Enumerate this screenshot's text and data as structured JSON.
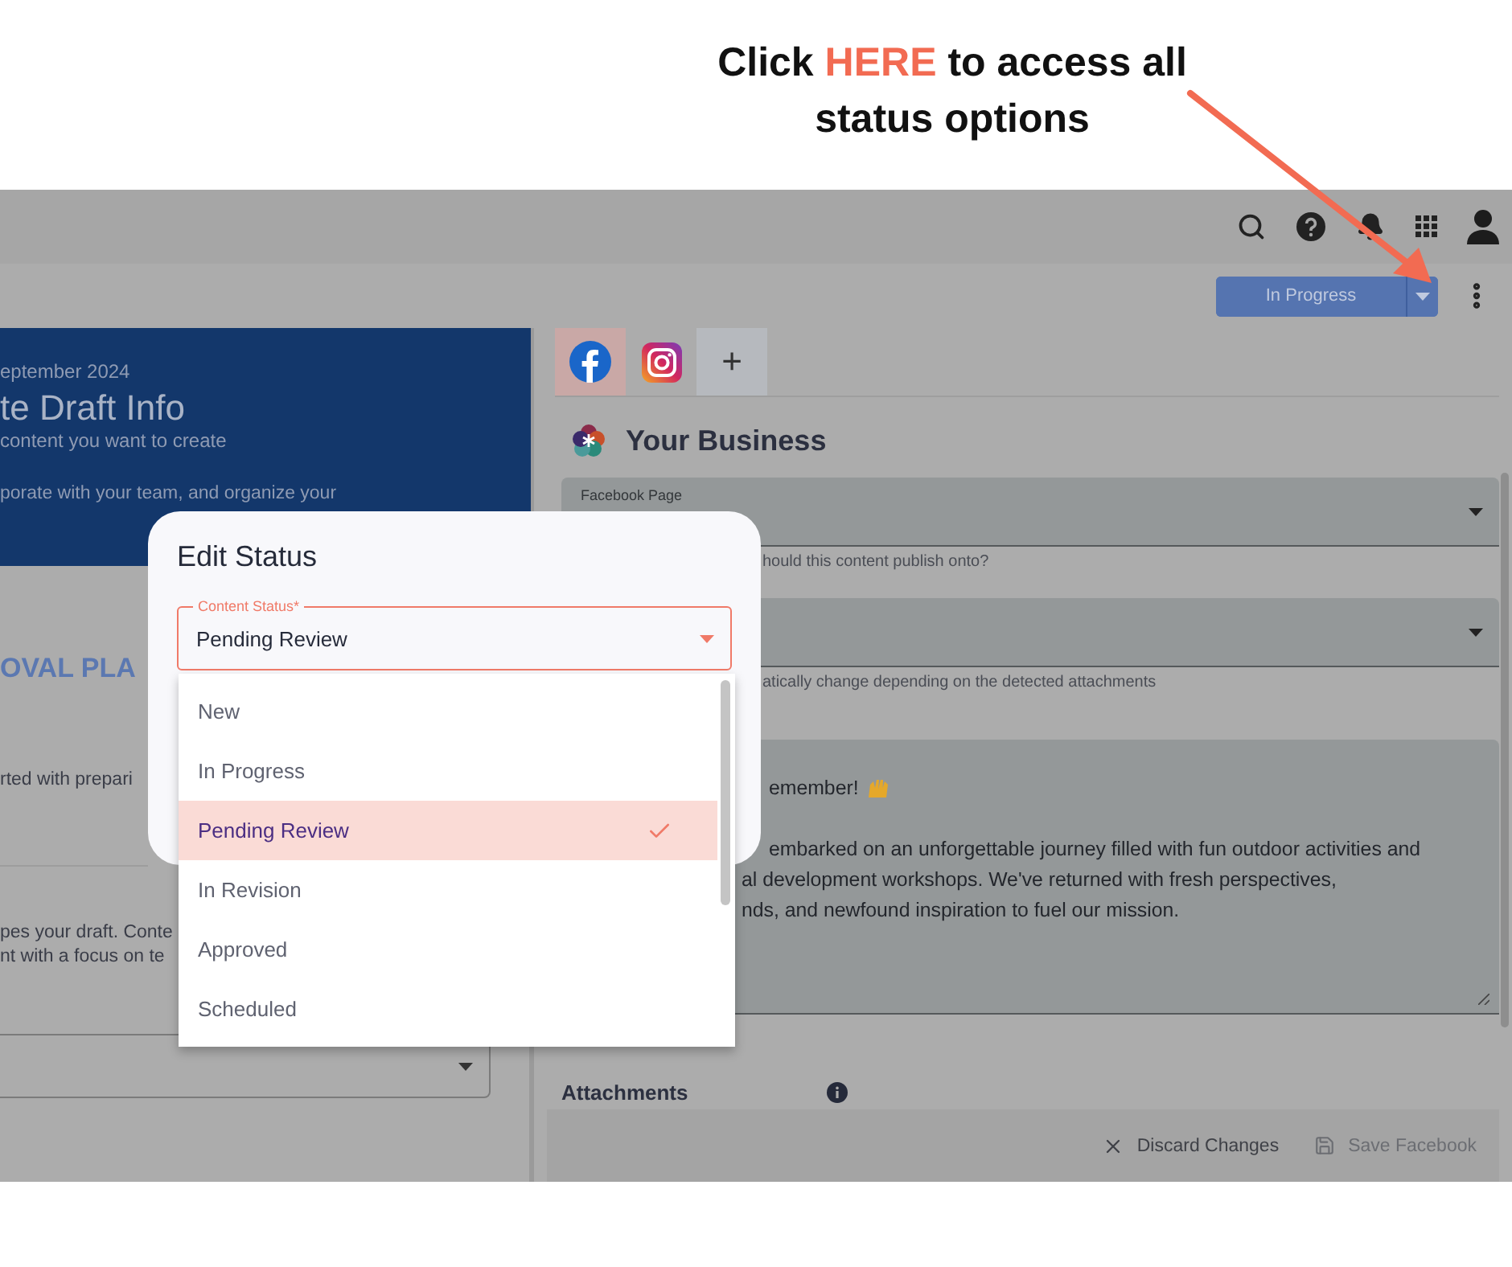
{
  "annotation": {
    "parts": [
      {
        "text": "Click ",
        "highlight": false
      },
      {
        "text": "HERE",
        "highlight": true
      },
      {
        "text": " to access all status options",
        "highlight": false
      }
    ]
  },
  "toolbar": {
    "status_button": "In Progress"
  },
  "left_panel": {
    "banner": {
      "date": "eptember 2024",
      "title": "te Draft Info",
      "subtitle": "content you want to create",
      "body": "porate with your team, and organize your"
    },
    "section_heading": "OVAL PLA",
    "intro": "rted with prepari",
    "description_lines": [
      "pes your draft. Conte",
      "nt with a focus on te"
    ]
  },
  "social_tabs": [
    {
      "kind": "facebook",
      "selected": true
    },
    {
      "kind": "instagram",
      "selected": false
    },
    {
      "kind": "add",
      "label": "+",
      "selected": false
    }
  ],
  "business": {
    "name": "Your Business",
    "fields": [
      {
        "label": "Facebook Page",
        "helper": "hould this content publish onto?"
      },
      {
        "helper": "atically change depending on the detected attachments"
      }
    ],
    "message_lines": [
      "emember!",
      "embarked on an unforgettable journey filled with fun outdoor activities and",
      "al development workshops. We've returned with fresh perspectives,",
      "nds, and newfound inspiration to fuel our mission."
    ],
    "attachments_label": "Attachments"
  },
  "footer": {
    "discard": "Discard Changes",
    "save": "Save Facebook",
    "save_disabled": true
  },
  "modal": {
    "title": "Edit Status",
    "field_label": "Content Status*",
    "value": "Pending Review",
    "options": [
      {
        "label": "New",
        "selected": false
      },
      {
        "label": "In Progress",
        "selected": false
      },
      {
        "label": "Pending Review",
        "selected": true
      },
      {
        "label": "In Revision",
        "selected": false
      },
      {
        "label": "Approved",
        "selected": false
      },
      {
        "label": "Scheduled",
        "selected": false
      }
    ]
  }
}
